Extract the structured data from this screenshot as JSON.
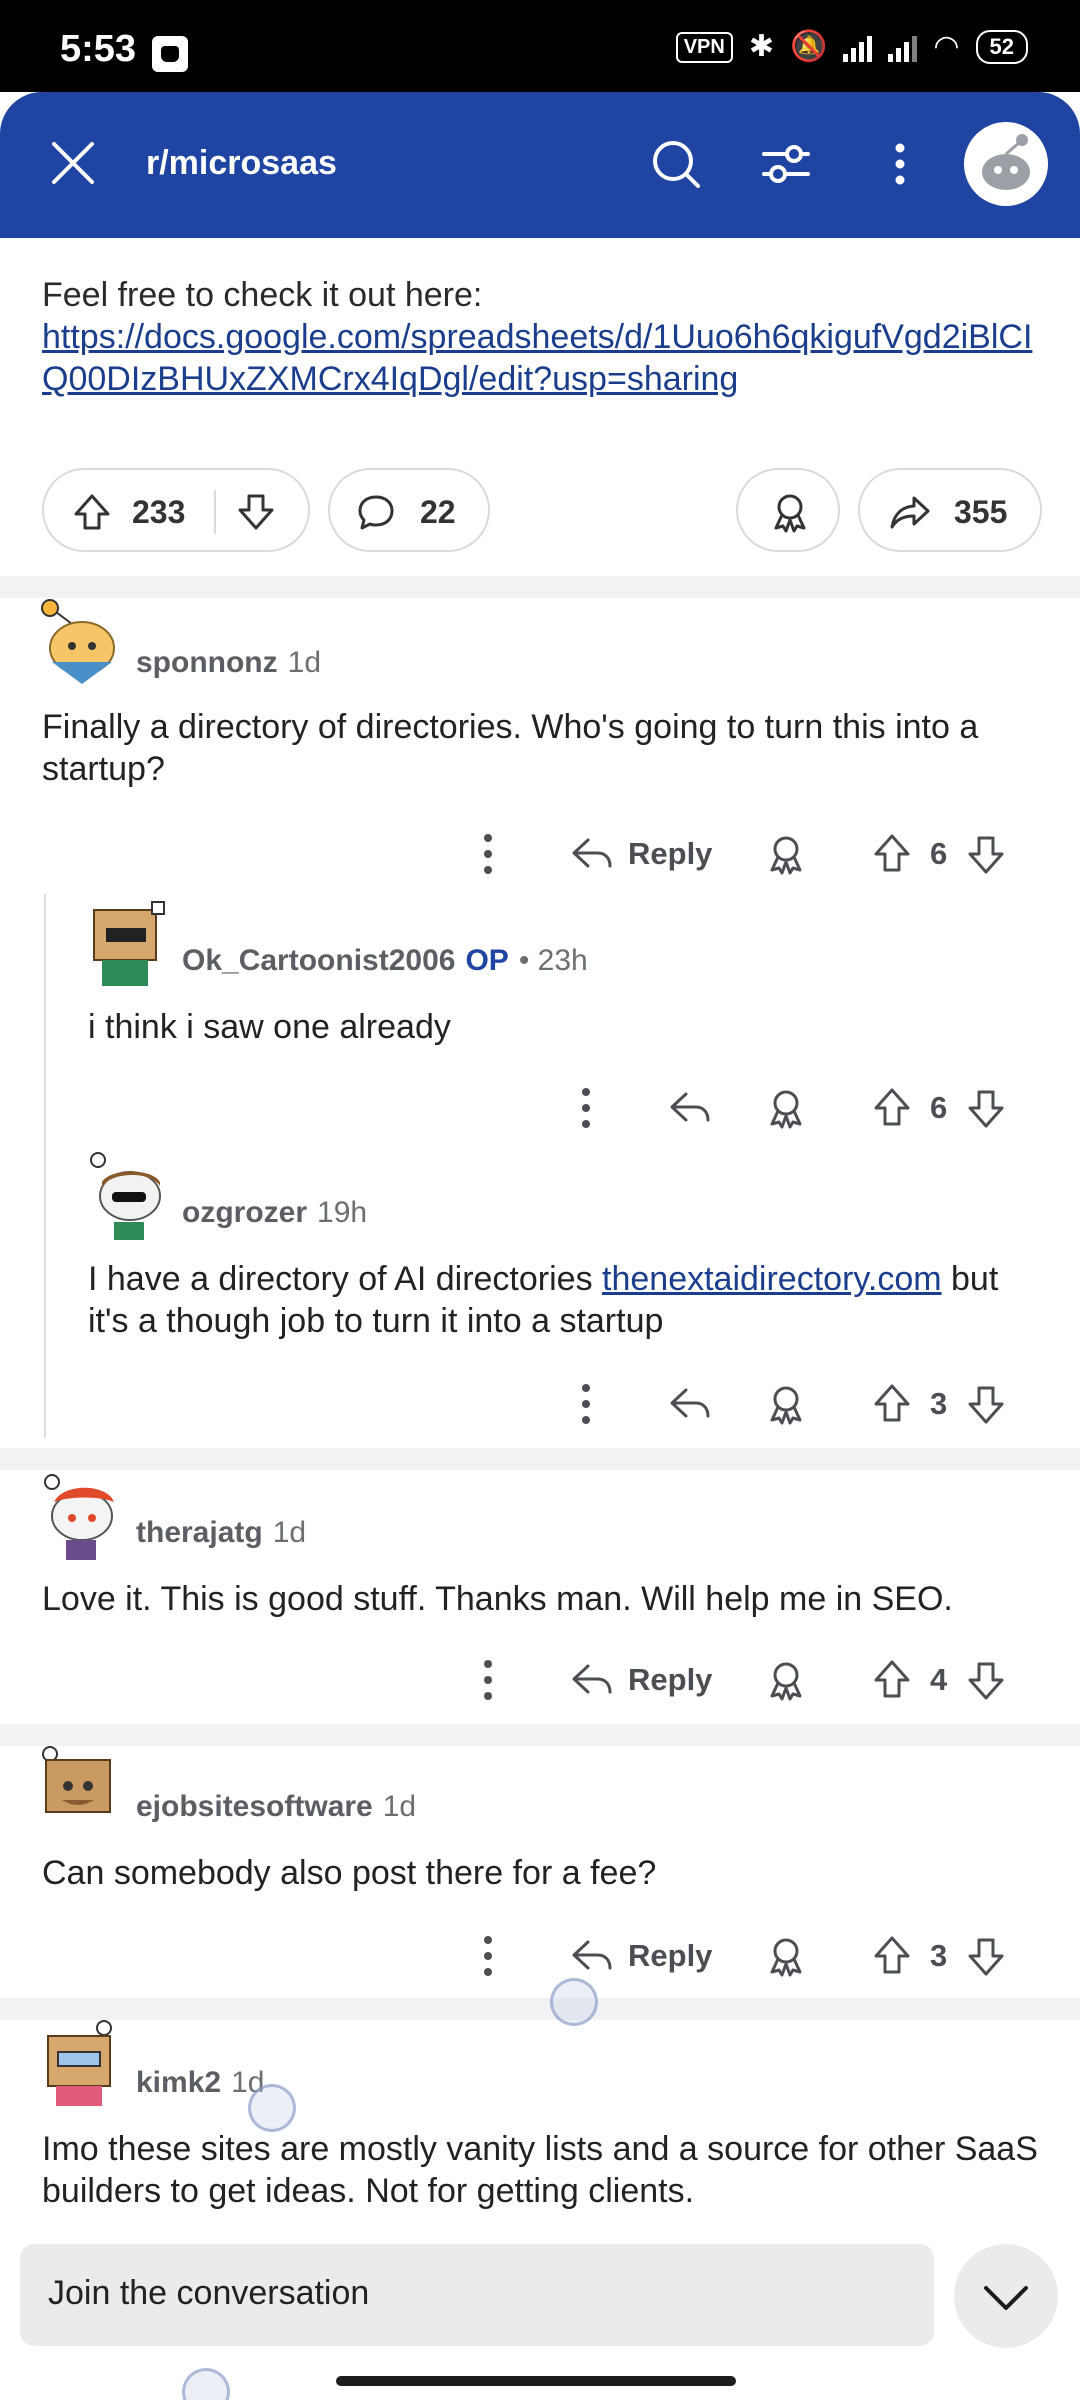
{
  "status_bar": {
    "time": "5:53",
    "vpn": "VPN",
    "battery": "52"
  },
  "app_bar": {
    "title": "r/microsaas"
  },
  "post": {
    "text_intro": "Feel free to check it out here:",
    "link": "https://docs.google.com/spreadsheets/d/1Uuo6h6qkigufVgd2iBlCIQ00DIzBHUxZXMCrx4IqDgl/edit?usp=sharing",
    "upvotes": "233",
    "comments": "22",
    "shares": "355"
  },
  "comments": [
    {
      "user": "sponnonz",
      "time": "1d",
      "body": "Finally a directory of directories. Who's going to turn this into a startup?",
      "reply_label": "Reply",
      "votes": "6"
    },
    {
      "user": "Ok_Cartoonist2006",
      "op": "OP",
      "time": "• 23h",
      "body": "i think i saw one already",
      "votes": "6"
    },
    {
      "user": "ozgrozer",
      "time": "19h",
      "body_before": "I have a directory of AI directories ",
      "link": "thenextaidirectory.com",
      "body_after": " but it's a though job to turn it into a startup",
      "votes": "3"
    },
    {
      "user": "therajatg",
      "time": "1d",
      "body": "Love it. This is good stuff. Thanks man. Will help me in SEO.",
      "reply_label": "Reply",
      "votes": "4"
    },
    {
      "user": "ejobsitesoftware",
      "time": "1d",
      "body": "Can somebody also post there for a fee?",
      "reply_label": "Reply",
      "votes": "3"
    },
    {
      "user": "kimk2",
      "time": "1d",
      "body": "Imo these sites are mostly vanity lists and a source for other SaaS builders to get ideas. Not for getting clients."
    }
  ],
  "bottom": {
    "placeholder": "Join the conversation"
  },
  "colors": {
    "brand": "#1f44a2",
    "link": "#1a3e8c"
  }
}
